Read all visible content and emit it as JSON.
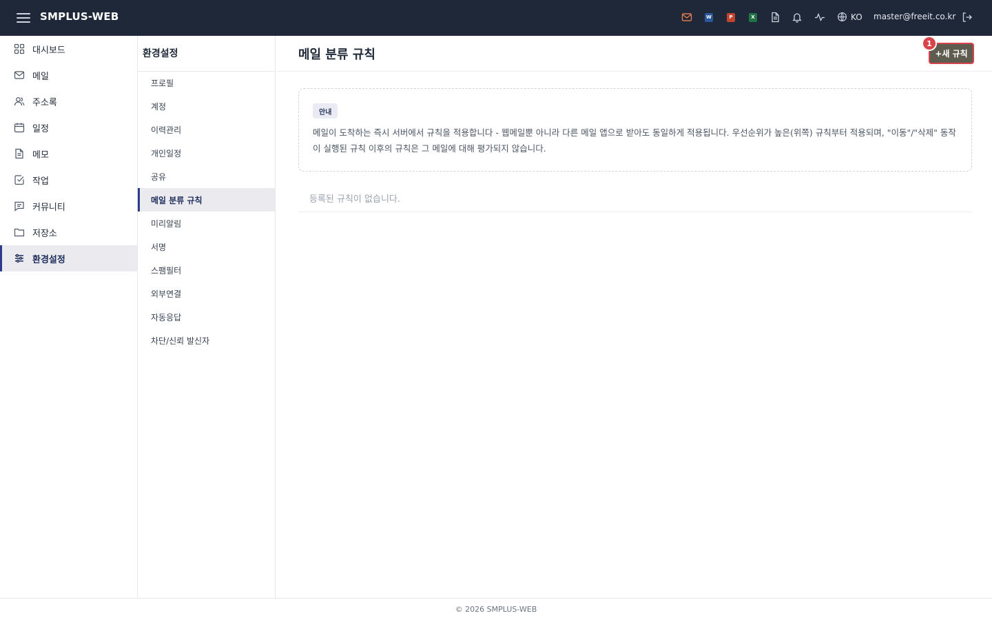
{
  "topbar": {
    "brand": "SMPLUS-WEB",
    "icons": [
      "mail-icon",
      "word-icon",
      "powerpoint-icon",
      "excel-icon",
      "document-icon",
      "bell-icon",
      "activity-icon",
      "globe-icon",
      "logout-icon"
    ],
    "word_letter": "W",
    "ppt_letter": "P",
    "excel_letter": "X",
    "language": "KO",
    "user_email": "master@freeit.co.kr",
    "colors": {
      "bar": "#1f2838",
      "mail": "#e07b4f",
      "word": "#2b579a",
      "ppt": "#c4432d",
      "excel": "#217346"
    }
  },
  "sidebar": {
    "items": [
      {
        "label": "대시보드",
        "icon": "grid-icon"
      },
      {
        "label": "메일",
        "icon": "mail-icon"
      },
      {
        "label": "주소록",
        "icon": "users-icon"
      },
      {
        "label": "일정",
        "icon": "calendar-icon"
      },
      {
        "label": "메모",
        "icon": "memo-icon"
      },
      {
        "label": "작업",
        "icon": "checkbox-icon"
      },
      {
        "label": "커뮤니티",
        "icon": "chat-icon"
      },
      {
        "label": "저장소",
        "icon": "folder-icon"
      },
      {
        "label": "환경설정",
        "icon": "sliders-icon"
      }
    ],
    "active_index": 8
  },
  "settings_nav": {
    "title": "환경설정",
    "items": [
      "프로필",
      "계정",
      "이력관리",
      "개인일정",
      "공유",
      "메일 분류 규칙",
      "미리알림",
      "서명",
      "스팸필터",
      "외부연결",
      "자동응답",
      "차단/신뢰 발신자"
    ],
    "active_index": 5
  },
  "main": {
    "title": "메일 분류 규칙",
    "new_rule_button": "+새 규칙",
    "button_badge": "1",
    "notice": {
      "tag": "안내",
      "text": "메일이 도착하는 즉시 서버에서 규칙을 적용합니다 - 웹메일뿐 아니라 다른 메일 앱으로 받아도 동일하게 적용됩니다. 우선순위가 높은(위쪽) 규칙부터 적용되며, \"이동\"/\"삭제\" 동작이 실행된 규칙 이후의 규칙은 그 메일에 대해 평가되지 않습니다."
    },
    "empty_message": "등록된 규칙이 없습니다."
  },
  "footer": {
    "text": "© 2026 SMPLUS-WEB"
  }
}
